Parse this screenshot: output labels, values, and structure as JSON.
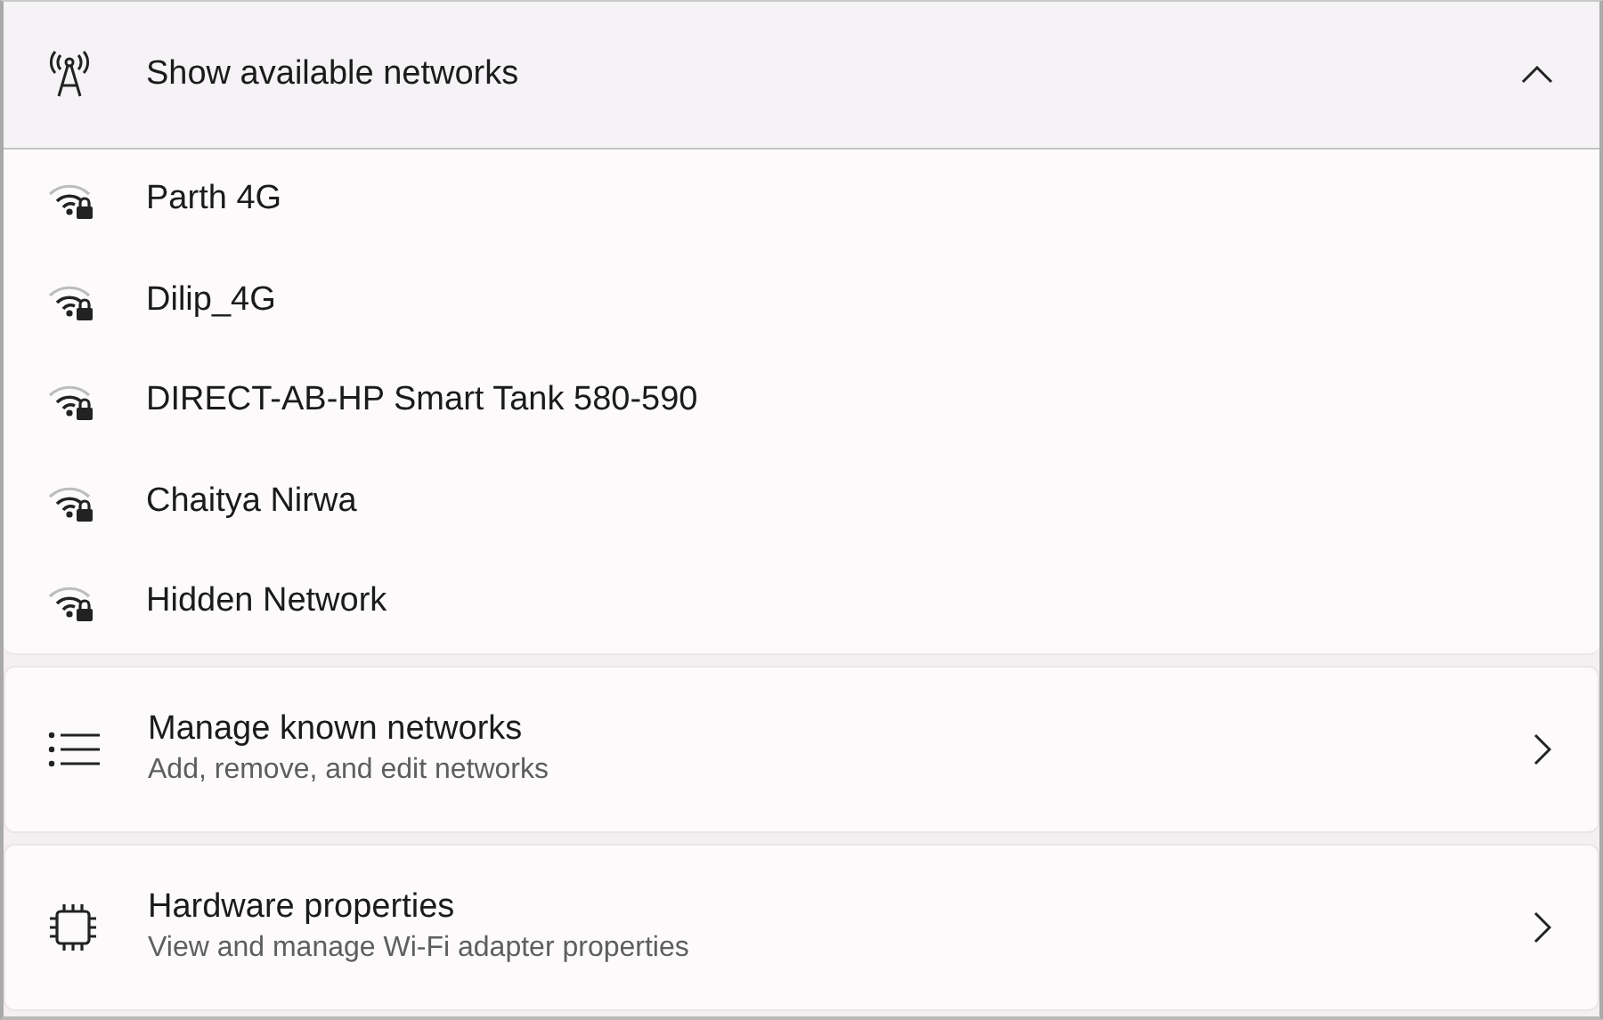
{
  "section": {
    "title": "Show available networks",
    "expanded": true
  },
  "networks": [
    {
      "name": "Parth 4G"
    },
    {
      "name": "Dilip_4G"
    },
    {
      "name": "DIRECT-AB-HP Smart Tank 580-590"
    },
    {
      "name": "Chaitya Nirwa"
    },
    {
      "name": "Hidden Network"
    }
  ],
  "settings": [
    {
      "kind": "list",
      "title": "Manage known networks",
      "description": "Add, remove, and edit networks"
    },
    {
      "kind": "chip",
      "title": "Hardware properties",
      "description": "View and manage Wi-Fi adapter properties"
    }
  ]
}
